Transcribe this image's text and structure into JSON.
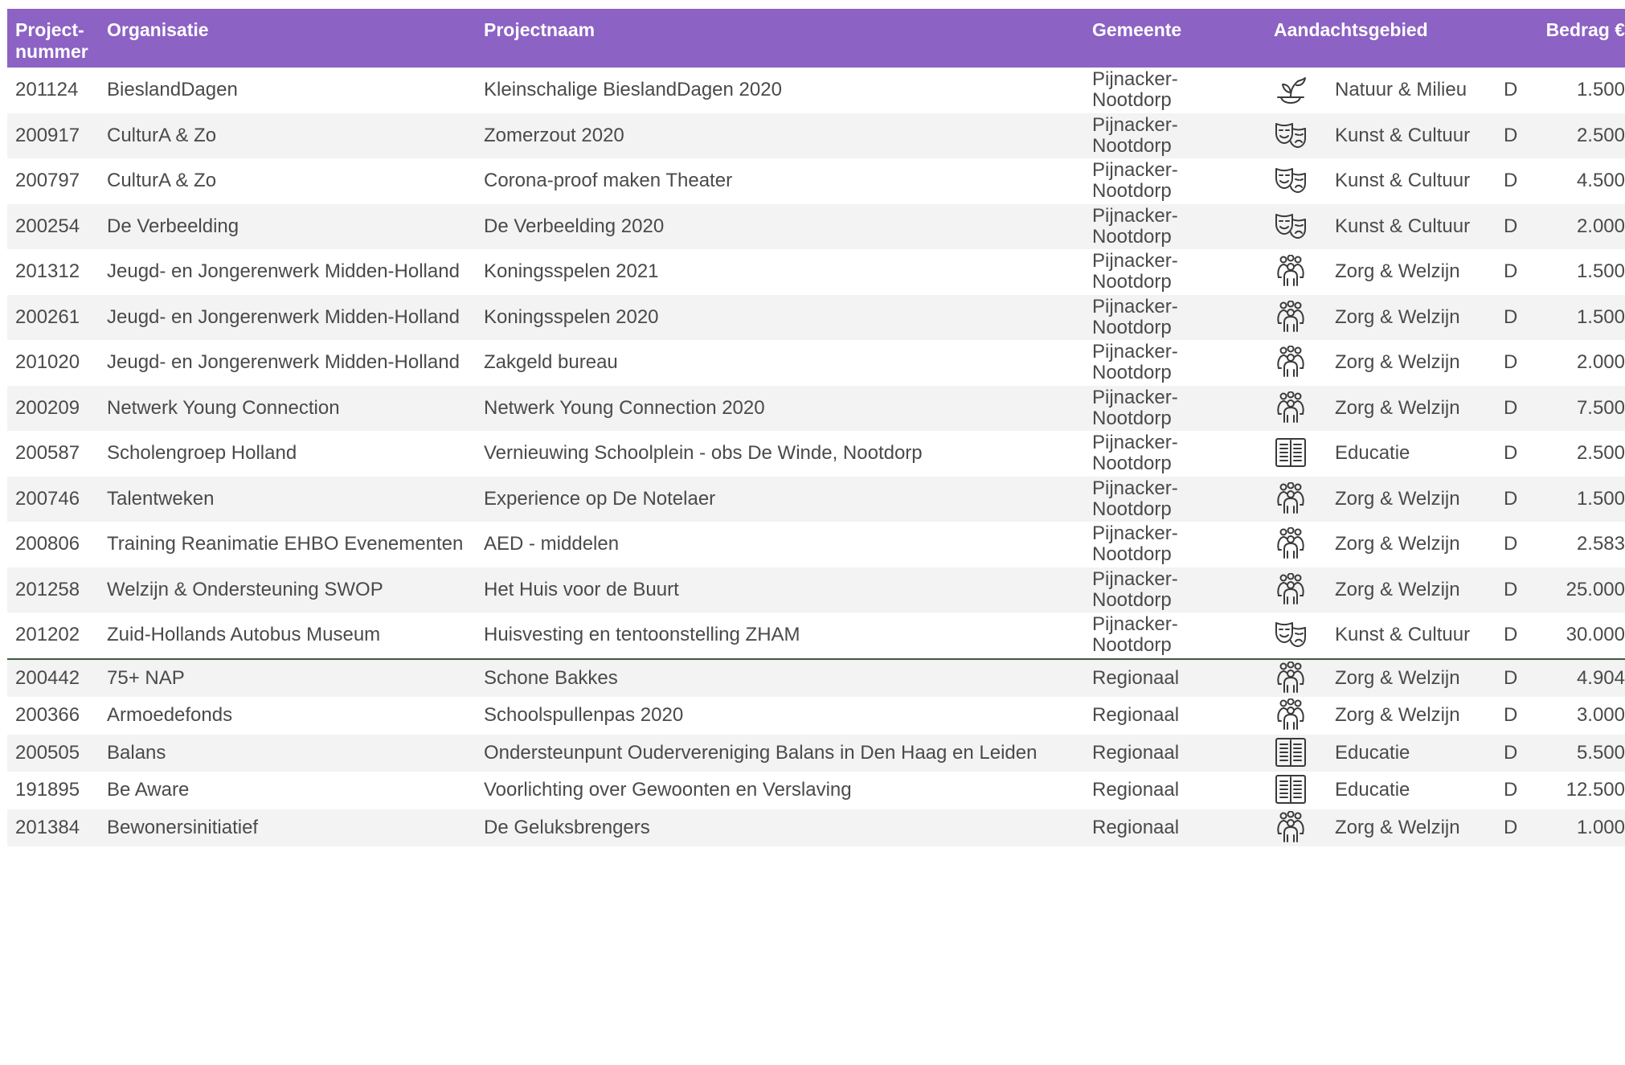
{
  "headers": {
    "nr": "Project-\nnummer",
    "org": "Organisatie",
    "proj": "Projectnaam",
    "gem": "Gemeente",
    "area": "Aandachtsgebied",
    "amt": "Bedrag €"
  },
  "colors": {
    "header_bg": "#8c62c4",
    "row_alt": "#f3f3f3",
    "divider": "#3d5a3d"
  },
  "rows": [
    {
      "nr": "201124",
      "org": "BieslandDagen",
      "proj": "Kleinschalige BieslandDagen 2020",
      "gem": "Pijnacker-Nootdorp",
      "icon": "plant-icon",
      "area": "Natuur & Milieu",
      "d": "D",
      "amt": "1.500"
    },
    {
      "nr": "200917",
      "org": "CulturA & Zo",
      "proj": "Zomerzout 2020",
      "gem": "Pijnacker-Nootdorp",
      "icon": "theater-masks-icon",
      "area": "Kunst & Cultuur",
      "d": "D",
      "amt": "2.500"
    },
    {
      "nr": "200797",
      "org": "CulturA & Zo",
      "proj": "Corona-proof maken Theater",
      "gem": "Pijnacker-Nootdorp",
      "icon": "theater-masks-icon",
      "area": "Kunst & Cultuur",
      "d": "D",
      "amt": "4.500"
    },
    {
      "nr": "200254",
      "org": "De Verbeelding",
      "proj": "De Verbeelding 2020",
      "gem": "Pijnacker-Nootdorp",
      "icon": "theater-masks-icon",
      "area": "Kunst & Cultuur",
      "d": "D",
      "amt": "2.000"
    },
    {
      "nr": "201312",
      "org": "Jeugd- en Jongerenwerk Midden-Holland",
      "proj": "Koningsspelen 2021",
      "gem": "Pijnacker-Nootdorp",
      "icon": "people-icon",
      "area": "Zorg & Welzijn",
      "d": "D",
      "amt": "1.500"
    },
    {
      "nr": "200261",
      "org": "Jeugd- en Jongerenwerk Midden-Holland",
      "proj": "Koningsspelen 2020",
      "gem": "Pijnacker-Nootdorp",
      "icon": "people-icon",
      "area": "Zorg & Welzijn",
      "d": "D",
      "amt": "1.500"
    },
    {
      "nr": "201020",
      "org": "Jeugd- en Jongerenwerk Midden-Holland",
      "proj": "Zakgeld bureau",
      "gem": "Pijnacker-Nootdorp",
      "icon": "people-icon",
      "area": "Zorg & Welzijn",
      "d": "D",
      "amt": "2.000"
    },
    {
      "nr": "200209",
      "org": "Netwerk Young Connection",
      "proj": "Netwerk Young Connection 2020",
      "gem": "Pijnacker-Nootdorp",
      "icon": "people-icon",
      "area": "Zorg & Welzijn",
      "d": "D",
      "amt": "7.500"
    },
    {
      "nr": "200587",
      "org": "Scholengroep Holland",
      "proj": "Vernieuwing Schoolplein - obs De Winde, Nootdorp",
      "gem": "Pijnacker-Nootdorp",
      "icon": "book-icon",
      "area": "Educatie",
      "d": "D",
      "amt": "2.500"
    },
    {
      "nr": "200746",
      "org": "Talentweken",
      "proj": "Experience op De Notelaer",
      "gem": "Pijnacker-Nootdorp",
      "icon": "people-icon",
      "area": "Zorg & Welzijn",
      "d": "D",
      "amt": "1.500"
    },
    {
      "nr": "200806",
      "org": "Training Reanimatie EHBO Evenementen",
      "proj": "AED - middelen",
      "gem": "Pijnacker-Nootdorp",
      "icon": "people-icon",
      "area": "Zorg & Welzijn",
      "d": "D",
      "amt": "2.583"
    },
    {
      "nr": "201258",
      "org": "Welzijn & Ondersteuning SWOP",
      "proj": "Het Huis voor de Buurt",
      "gem": "Pijnacker-Nootdorp",
      "icon": "people-icon",
      "area": "Zorg & Welzijn",
      "d": "D",
      "amt": "25.000"
    },
    {
      "nr": "201202",
      "org": "Zuid-Hollands Autobus Museum",
      "proj": "Huisvesting en tentoonstelling ZHAM",
      "gem": "Pijnacker-Nootdorp",
      "icon": "theater-masks-icon",
      "area": "Kunst & Cultuur",
      "d": "D",
      "amt": "30.000"
    },
    {
      "nr": "200442",
      "org": "75+ NAP",
      "proj": "Schone Bakkes",
      "gem": "Regionaal",
      "icon": "people-icon",
      "area": "Zorg & Welzijn",
      "d": "D",
      "amt": "4.904"
    },
    {
      "nr": "200366",
      "org": "Armoedefonds",
      "proj": "Schoolspullenpas 2020",
      "gem": "Regionaal",
      "icon": "people-icon",
      "area": "Zorg & Welzijn",
      "d": "D",
      "amt": "3.000"
    },
    {
      "nr": "200505",
      "org": "Balans",
      "proj": "Ondersteunpunt Oudervereniging Balans in Den Haag en Leiden",
      "gem": "Regionaal",
      "icon": "book-icon",
      "area": "Educatie",
      "d": "D",
      "amt": "5.500"
    },
    {
      "nr": "191895",
      "org": "Be Aware",
      "proj": "Voorlichting over Gewoonten en Verslaving",
      "gem": "Regionaal",
      "icon": "book-icon",
      "area": "Educatie",
      "d": "D",
      "amt": "12.500"
    },
    {
      "nr": "201384",
      "org": "Bewonersinitiatief",
      "proj": "De Geluksbrengers",
      "gem": "Regionaal",
      "icon": "people-icon",
      "area": "Zorg & Welzijn",
      "d": "D",
      "amt": "1.000"
    }
  ]
}
